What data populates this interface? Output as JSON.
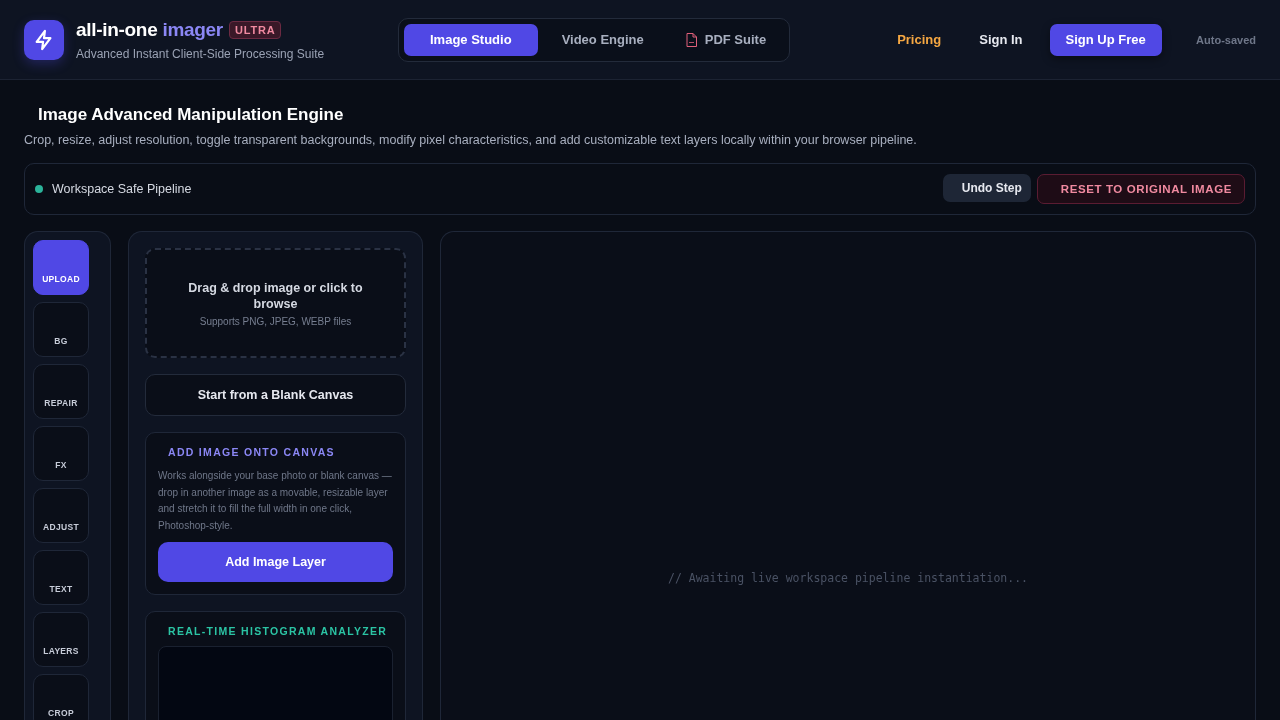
{
  "brand": {
    "name": "all-in-one",
    "accent": "imager",
    "badge": "ULTRA",
    "tagline": "Advanced Instant Client-Side Processing Suite"
  },
  "modes": [
    {
      "label": "Image Studio",
      "selected": true,
      "kind": "plain"
    },
    {
      "label": "Video Engine",
      "selected": false,
      "kind": "plain"
    },
    {
      "label": "PDF Suite",
      "selected": false,
      "kind": "pdf"
    }
  ],
  "nav": [
    {
      "label": "Pricing",
      "kind": "highlight"
    },
    {
      "label": "Sign In",
      "kind": "link"
    },
    {
      "label": "Sign Up Free",
      "kind": "primary"
    }
  ],
  "save_status": "Auto-saved",
  "page": {
    "title": "Image Advanced Manipulation Engine",
    "description": "Crop, resize, adjust resolution, toggle transparent backgrounds, modify pixel characteristics, and add customizable text layers locally within your browser pipeline."
  },
  "status_bar": {
    "label": "Workspace Safe Pipeline",
    "color": "#2bb39a",
    "buttons": [
      {
        "label": "Undo Step",
        "kind": "secondary"
      },
      {
        "label": "RESET TO ORIGINAL IMAGE",
        "kind": "danger"
      }
    ]
  },
  "tools": [
    {
      "label": "UPLOAD",
      "selected": true
    },
    {
      "label": "BG",
      "selected": false
    },
    {
      "label": "REPAIR",
      "selected": false
    },
    {
      "label": "FX",
      "selected": false
    },
    {
      "label": "ADJUST",
      "selected": false
    },
    {
      "label": "TEXT",
      "selected": false
    },
    {
      "label": "LAYERS",
      "selected": false
    },
    {
      "label": "CROP",
      "selected": false
    }
  ],
  "dropzone": {
    "title": "Drag & drop image or click to browse",
    "hint": "Supports PNG, JPEG, WEBP files"
  },
  "blank_button": "Start from a Blank Canvas",
  "add_layer": {
    "heading": "ADD IMAGE ONTO CANVAS",
    "text": "Works alongside your base photo or blank canvas — drop in another image as a movable, resizable layer and stretch it to fill the full width in one click, Photoshop-style.",
    "button": "Add Image Layer"
  },
  "histogram": {
    "heading": "REAL-TIME HISTOGRAM ANALYZER"
  },
  "canvas": {
    "placeholder": "// Awaiting live workspace pipeline instantiation..."
  }
}
